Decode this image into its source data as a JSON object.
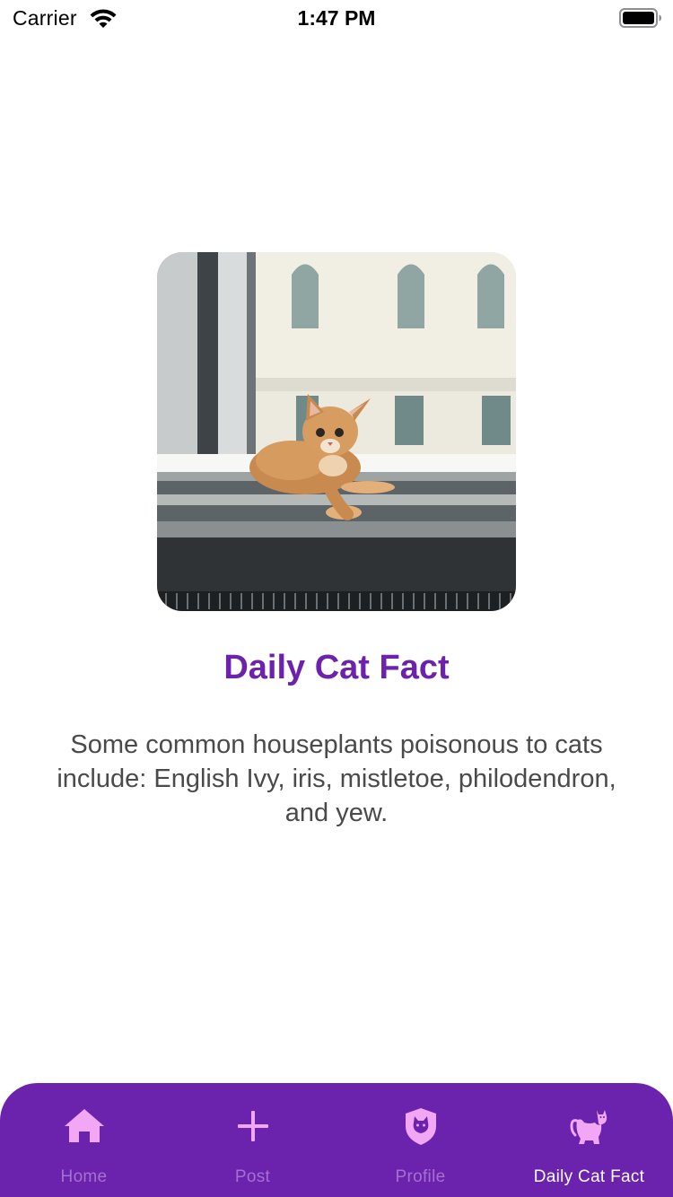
{
  "status_bar": {
    "carrier": "Carrier",
    "time": "1:47 PM"
  },
  "content": {
    "image_icon": "cat-photo",
    "title": "Daily Cat Fact",
    "fact": "Some common houseplants poisonous to cats include: English Ivy, iris, mistletoe, philodendron, and yew."
  },
  "tab_bar": {
    "background_color": "#6b22ad",
    "icon_color": "#f2a7f5",
    "inactive_label_color": "#a371cf",
    "active_label_color": "#ffffff",
    "tabs": [
      {
        "label": "Home",
        "icon": "home-icon",
        "active": false
      },
      {
        "label": "Post",
        "icon": "plus-icon",
        "active": false
      },
      {
        "label": "Profile",
        "icon": "cat-shield-icon",
        "active": false
      },
      {
        "label": "Daily Cat Fact",
        "icon": "cat-icon",
        "active": true
      }
    ]
  },
  "title_color": "#6c22ad"
}
